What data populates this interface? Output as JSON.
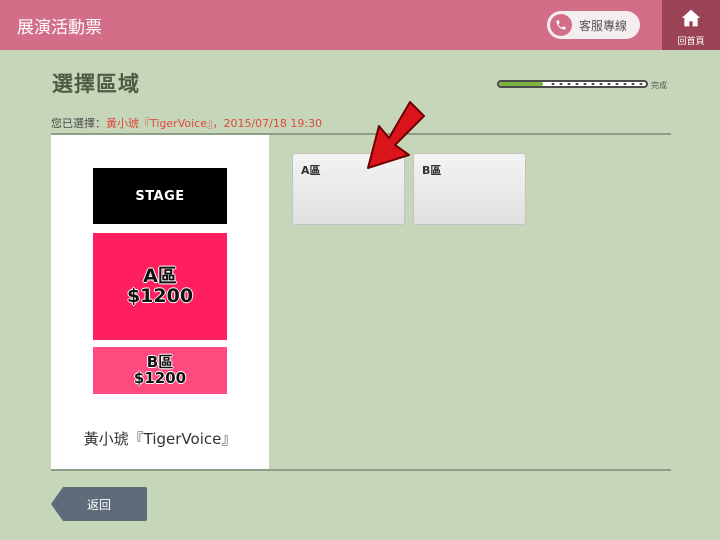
{
  "header": {
    "title": "展演活動票",
    "hotline_label": "客服專線",
    "home_label": "回首頁"
  },
  "page": {
    "title": "選擇區域",
    "progress_label": "完成",
    "progress_fraction": 0.3
  },
  "selection": {
    "prefix": "您已選擇：",
    "event": "黃小琥『TigerVoice』",
    "separator": "，",
    "datetime": "2015/07/18 19:30"
  },
  "venue_map": {
    "stage_label": "STAGE",
    "zones": [
      {
        "name": "A區",
        "price": "$1200"
      },
      {
        "name": "B區",
        "price": "$1200"
      }
    ],
    "caption": "黃小琥『TigerVoice』"
  },
  "areas": [
    {
      "label": "A區"
    },
    {
      "label": "B區"
    }
  ],
  "footer": {
    "back_label": "返回"
  },
  "colors": {
    "header_bg": "#d36e88",
    "home_bg": "#9a4357",
    "page_bg": "#c6d7b9",
    "zone_a": "#ff1f5f",
    "zone_b": "#ff4a80",
    "progress_fill": "#7cb342",
    "highlight_text": "#e0483f",
    "arrow": "#d9141a"
  },
  "icons": {
    "hotline": "phone-icon",
    "home": "home-icon",
    "pointer": "red-arrow-icon"
  }
}
